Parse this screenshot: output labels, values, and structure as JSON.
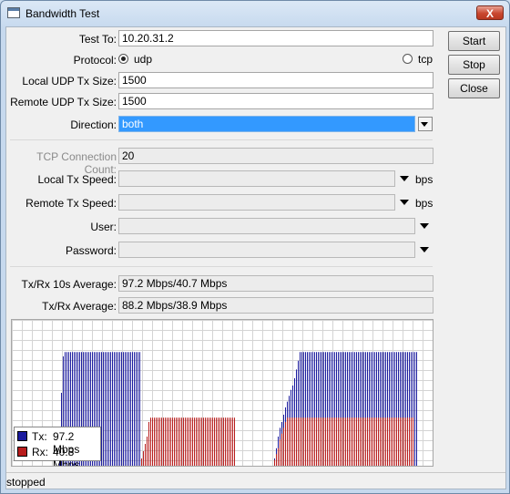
{
  "window": {
    "title": "Bandwidth Test",
    "close": "X"
  },
  "buttons": {
    "start": "Start",
    "stop": "Stop",
    "close": "Close"
  },
  "form": {
    "test_to": {
      "label": "Test To:",
      "value": "10.20.31.2"
    },
    "protocol": {
      "label": "Protocol:",
      "options": [
        "udp",
        "tcp"
      ],
      "selected": "udp"
    },
    "local_udp_tx_size": {
      "label": "Local UDP Tx Size:",
      "value": "1500"
    },
    "remote_udp_tx_size": {
      "label": "Remote UDP Tx Size:",
      "value": "1500"
    },
    "direction": {
      "label": "Direction:",
      "value": "both"
    },
    "tcp_connection_count": {
      "label": "TCP Connection Count:",
      "value": "20"
    },
    "local_tx_speed": {
      "label": "Local Tx Speed:",
      "value": "",
      "unit": "bps"
    },
    "remote_tx_speed": {
      "label": "Remote Tx Speed:",
      "value": "",
      "unit": "bps"
    },
    "user": {
      "label": "User:",
      "value": ""
    },
    "password": {
      "label": "Password:",
      "value": ""
    },
    "avg_10s": {
      "label": "Tx/Rx 10s Average:",
      "value": "97.2 Mbps/40.7 Mbps"
    },
    "avg": {
      "label": "Tx/Rx Average:",
      "value": "88.2 Mbps/38.9 Mbps"
    }
  },
  "graph": {
    "legend": {
      "tx_label": "Tx:",
      "tx_value": "97.2 Mbps",
      "rx_label": "Rx:",
      "rx_value": "40.8 Mbps"
    },
    "tx_color": "#1a1a9e",
    "rx_color": "#b81c1c",
    "grid_color": "#d4d4d4",
    "tx_levels": [
      0,
      0,
      0,
      0,
      0,
      0,
      0,
      0,
      0,
      0,
      0,
      0,
      0,
      0,
      0,
      0,
      0,
      0,
      0,
      0,
      0,
      0,
      0,
      0,
      0,
      0.25,
      0.5,
      0.75,
      0.78,
      0.78,
      0.78,
      0.78,
      0.78,
      0.78,
      0.78,
      0.78,
      0.78,
      0.78,
      0.78,
      0.78,
      0.78,
      0.78,
      0.78,
      0.78,
      0.78,
      0.78,
      0.78,
      0.78,
      0.78,
      0.78,
      0.78,
      0.78,
      0.78,
      0.78,
      0.78,
      0.78,
      0.78,
      0.78,
      0.78,
      0.78,
      0.78,
      0.78,
      0.78,
      0.78,
      0.78,
      0.78,
      0.78,
      0.78,
      0.78,
      0.78,
      0,
      0,
      0,
      0,
      0,
      0,
      0,
      0,
      0,
      0,
      0,
      0,
      0,
      0,
      0,
      0,
      0,
      0,
      0,
      0,
      0,
      0,
      0,
      0,
      0,
      0,
      0,
      0,
      0,
      0,
      0,
      0,
      0,
      0,
      0,
      0,
      0,
      0,
      0,
      0,
      0,
      0,
      0,
      0,
      0,
      0,
      0,
      0,
      0,
      0,
      0,
      0,
      0,
      0,
      0,
      0,
      0,
      0,
      0,
      0,
      0,
      0,
      0,
      0,
      0,
      0,
      0,
      0,
      0,
      0,
      0,
      0,
      0,
      0.05,
      0.12,
      0.2,
      0.26,
      0.3,
      0.35,
      0.4,
      0.44,
      0.48,
      0.52,
      0.55,
      0.6,
      0.66,
      0.72,
      0.78,
      0.78,
      0.78,
      0.78,
      0.78,
      0.78,
      0.78,
      0.78,
      0.78,
      0.78,
      0.78,
      0.78,
      0.78,
      0.78,
      0.78,
      0.78,
      0.78,
      0.78,
      0.78,
      0.78,
      0.78,
      0.78,
      0.78,
      0.78,
      0.78,
      0.78,
      0.78,
      0.78,
      0.78,
      0.78,
      0.78,
      0.78,
      0.78,
      0.78,
      0.78,
      0.78,
      0.78,
      0.78,
      0.78,
      0.78,
      0.78,
      0.78,
      0.78,
      0.78,
      0.78,
      0.78,
      0.78,
      0.78,
      0.78,
      0.78,
      0.78,
      0.78,
      0.78,
      0.78,
      0.78,
      0.78,
      0.78,
      0.78,
      0.78,
      0.78,
      0.78,
      0.78,
      0.78,
      0.78,
      0.78
    ],
    "rx_levels": [
      0,
      0,
      0,
      0,
      0,
      0,
      0,
      0,
      0,
      0,
      0,
      0,
      0,
      0,
      0,
      0,
      0,
      0,
      0,
      0,
      0,
      0,
      0,
      0,
      0,
      0,
      0,
      0,
      0,
      0,
      0,
      0,
      0,
      0,
      0,
      0,
      0,
      0,
      0,
      0,
      0,
      0,
      0,
      0,
      0,
      0,
      0,
      0,
      0,
      0,
      0,
      0,
      0,
      0,
      0,
      0,
      0,
      0,
      0,
      0,
      0,
      0,
      0,
      0,
      0,
      0,
      0,
      0,
      0,
      0,
      0.05,
      0.1,
      0.15,
      0.2,
      0.3,
      0.33,
      0.33,
      0.33,
      0.33,
      0.33,
      0.33,
      0.33,
      0.33,
      0.33,
      0.33,
      0.33,
      0.33,
      0.33,
      0.33,
      0.33,
      0.33,
      0.33,
      0.33,
      0.33,
      0.33,
      0.33,
      0.33,
      0.33,
      0.33,
      0.33,
      0.33,
      0.33,
      0.33,
      0.33,
      0.33,
      0.33,
      0.33,
      0.33,
      0.33,
      0.33,
      0.33,
      0.33,
      0.33,
      0.33,
      0.33,
      0.33,
      0.33,
      0.33,
      0.33,
      0.33,
      0.33,
      0.33,
      0,
      0,
      0,
      0,
      0,
      0,
      0,
      0,
      0,
      0,
      0,
      0,
      0,
      0,
      0,
      0,
      0,
      0,
      0,
      0,
      0,
      0.04,
      0.08,
      0.12,
      0.18,
      0.22,
      0.26,
      0.3,
      0.33,
      0.33,
      0.33,
      0.33,
      0.33,
      0.33,
      0.33,
      0.33,
      0.33,
      0.33,
      0.33,
      0.33,
      0.33,
      0.33,
      0.33,
      0.33,
      0.33,
      0.33,
      0.33,
      0.33,
      0.33,
      0.33,
      0.33,
      0.33,
      0.33,
      0.33,
      0.33,
      0.33,
      0.33,
      0.33,
      0.33,
      0.33,
      0.33,
      0.33,
      0.33,
      0.33,
      0.33,
      0.33,
      0.33,
      0.33,
      0.33,
      0.33,
      0.33,
      0.33,
      0.33,
      0.33,
      0.33,
      0.33,
      0.33,
      0.33,
      0.33,
      0.33,
      0.33,
      0.33,
      0.33,
      0.33,
      0.33,
      0.33,
      0.33,
      0.33,
      0.33,
      0.33,
      0.33,
      0.33,
      0.33,
      0.33,
      0.33,
      0.33,
      0.33,
      0.33
    ]
  },
  "status": "stopped"
}
